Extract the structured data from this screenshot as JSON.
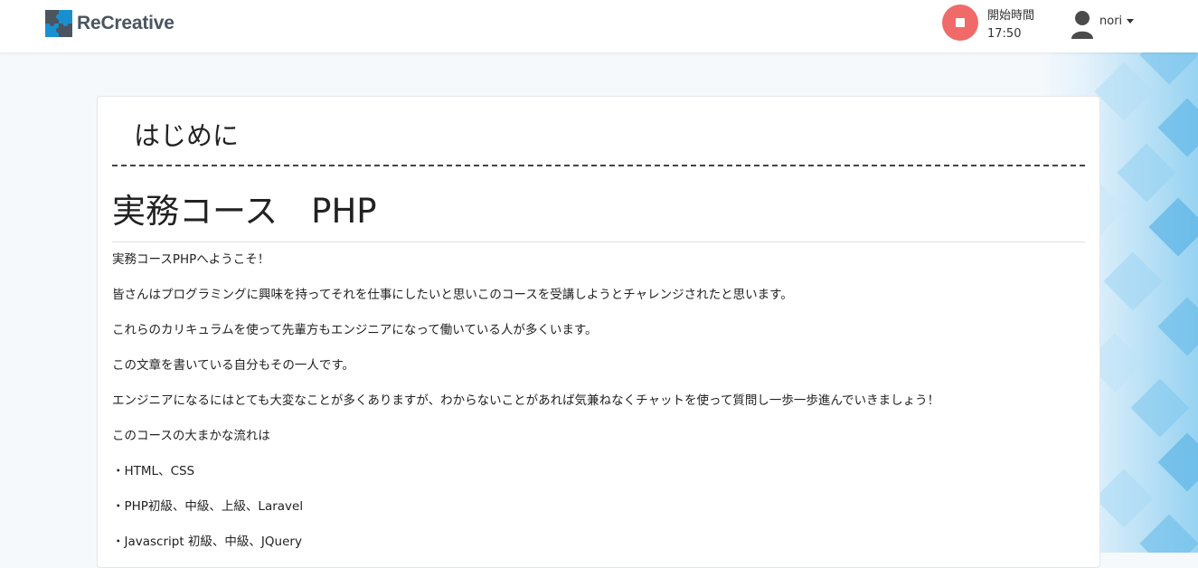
{
  "header": {
    "logo_text": "ReCreative",
    "timer_label": "開始時間",
    "timer_value": "17:50",
    "user_name": "nori"
  },
  "content": {
    "section_title": "はじめに",
    "course_title": "実務コース　PHP",
    "paragraphs": [
      "実務コースPHPへようこそ！",
      "皆さんはプログラミングに興味を持ってそれを仕事にしたいと思いこのコースを受講しようとチャレンジされたと思います。",
      "これらのカリキュラムを使って先輩方もエンジニアになって働いている人が多くいます。",
      "この文章を書いている自分もその一人です。",
      "エンジニアになるにはとても大変なことが多くありますが、わからないことがあれば気兼ねなくチャットを使って質問し一歩一歩進んでいきましょう！",
      "このコースの大まかな流れは",
      "・HTML、CSS",
      "・PHP初級、中級、上級、Laravel",
      "・Javascript 初級、中級、JQuery"
    ]
  },
  "colors": {
    "stop_button": "#f06a6a",
    "logo_blue": "#1a8fd0",
    "logo_gray": "#4a5560"
  },
  "icons": {
    "logo": "puzzle-logo-icon",
    "stop": "stop-icon",
    "user": "user-icon",
    "dropdown": "caret-down-icon"
  }
}
